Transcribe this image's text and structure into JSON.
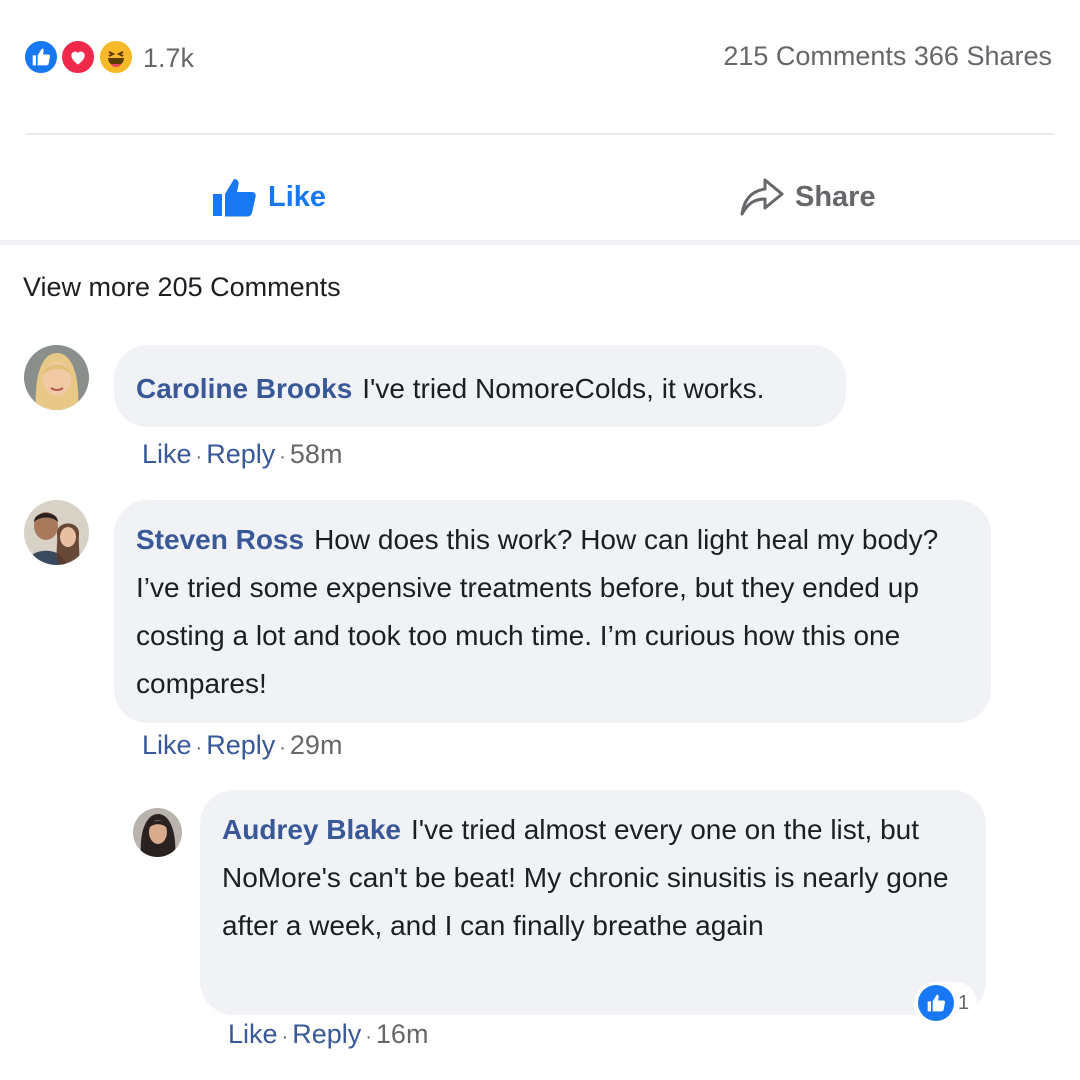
{
  "post": {
    "reactions": {
      "icons": [
        "like-icon",
        "love-icon",
        "haha-icon"
      ],
      "count": "1.7k"
    },
    "stats": "215 Comments 366 Shares",
    "actions": {
      "like_label": "Like",
      "share_label": "Share"
    },
    "view_more": "View more 205 Comments"
  },
  "comments": [
    {
      "author": "Caroline Brooks",
      "text": "I've tried NomoreColds, it works.",
      "like_label": "Like",
      "reply_label": "Reply",
      "time": "58m"
    },
    {
      "author": "Steven Ross",
      "text": "How does this work? How can light heal my body? I’ve tried some expensive treatments before, but they ended up costing a lot and took too much time. I’m curious how this one compares!",
      "like_label": "Like",
      "reply_label": "Reply",
      "time": "29m"
    },
    {
      "author": "Audrey Blake",
      "text": "I've tried almost every one on the list, but NoMore's can't be beat! My chronic sinusitis is nearly gone after a week, and I can finally breathe again",
      "like_label": "Like",
      "reply_label": "Reply",
      "time": "16m",
      "like_count": "1"
    }
  ],
  "colors": {
    "link_blue": "#385898",
    "brand_blue": "#1877f2",
    "bubble_bg": "#f0f2f5",
    "muted": "#65676b"
  }
}
